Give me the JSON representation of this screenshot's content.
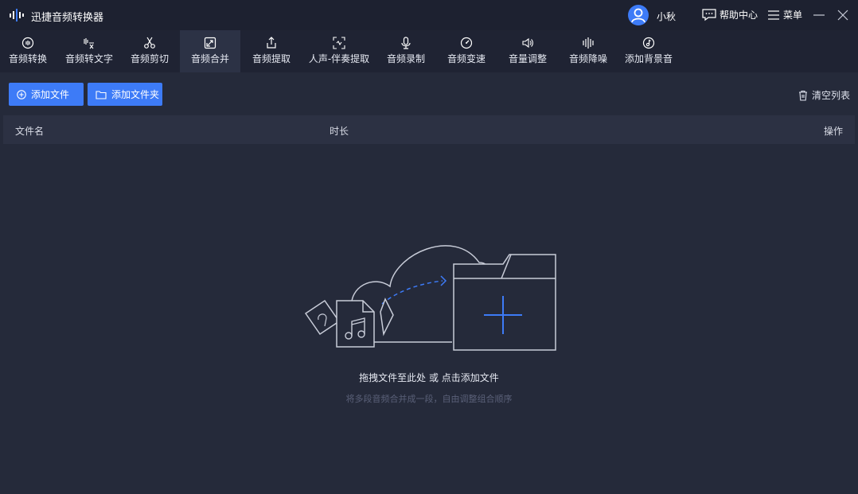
{
  "app": {
    "title": "迅捷音频转换器"
  },
  "user": {
    "name": "小秋"
  },
  "header": {
    "help_label": "帮助中心",
    "menu_label": "菜单"
  },
  "tools": [
    {
      "label": "音频转换",
      "icon": "convert-icon"
    },
    {
      "label": "音频转文字",
      "icon": "audio-to-text-icon"
    },
    {
      "label": "音频剪切",
      "icon": "scissors-icon"
    },
    {
      "label": "音频合并",
      "icon": "merge-icon",
      "active": true
    },
    {
      "label": "音频提取",
      "icon": "extract-icon"
    },
    {
      "label": "人声-伴奏提取",
      "icon": "vocal-extract-icon"
    },
    {
      "label": "音频录制",
      "icon": "microphone-icon"
    },
    {
      "label": "音频变速",
      "icon": "speed-icon"
    },
    {
      "label": "音量调整",
      "icon": "volume-icon"
    },
    {
      "label": "音频降噪",
      "icon": "denoise-icon"
    },
    {
      "label": "添加背景音",
      "icon": "bg-music-icon"
    }
  ],
  "actions": {
    "add_file": "添加文件",
    "add_folder": "添加文件夹",
    "clear_list": "清空列表"
  },
  "table": {
    "columns": [
      "文件名",
      "时长",
      "操作"
    ]
  },
  "empty": {
    "main": "拖拽文件至此处 或 点击添加文件",
    "sub": "将多段音频合并成一段，自由调整组合顺序"
  },
  "colors": {
    "accent": "#3d7bf7",
    "titlebar": "#1d2130",
    "background": "#252a3a"
  }
}
